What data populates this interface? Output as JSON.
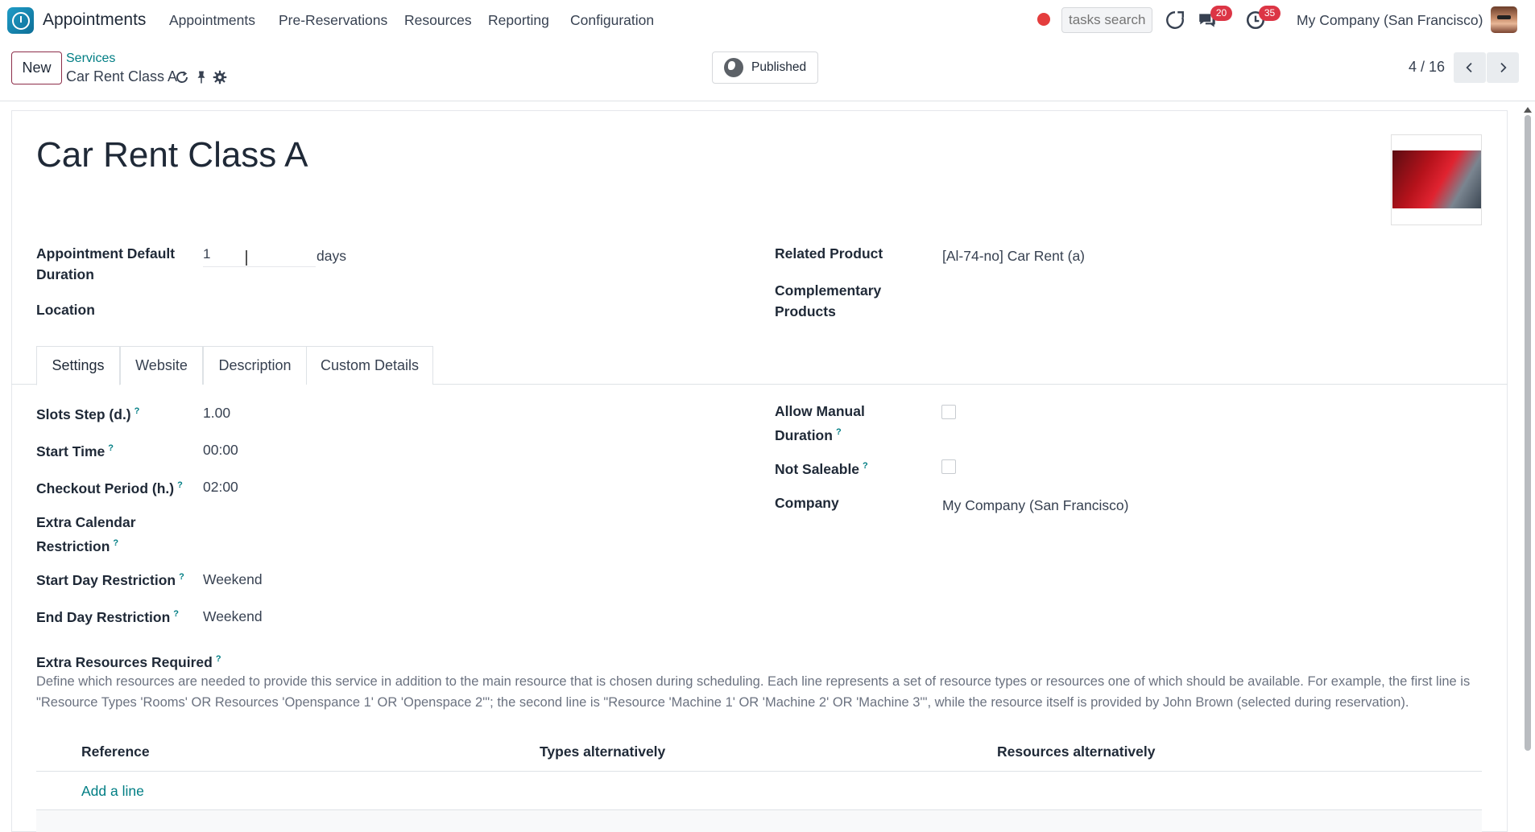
{
  "navbar": {
    "app_name": "Appointments",
    "menu": [
      "Appointments",
      "Pre-Reservations",
      "Resources",
      "Reporting",
      "Configuration"
    ],
    "search_placeholder": "tasks search",
    "messages_count": "20",
    "activities_count": "35",
    "company": "My Company (San Francisco)"
  },
  "control": {
    "new_label": "New",
    "breadcrumb_parent": "Services",
    "breadcrumb_current": "Car Rent Class A",
    "published_label": "Published",
    "pager": "4 / 16"
  },
  "record": {
    "title": "Car Rent Class A",
    "duration_label": "Appointment Default Duration",
    "duration_value": "1",
    "duration_unit": "days",
    "location_label": "Location",
    "related_product_label": "Related Product",
    "related_product_value": "[Al-74-no] Car Rent (a)",
    "complementary_label": "Complementary Products"
  },
  "tabs": [
    "Settings",
    "Website",
    "Description",
    "Custom Details"
  ],
  "settings": {
    "slots_step_label": "Slots Step (d.)",
    "slots_step_value": "1.00",
    "start_time_label": "Start Time",
    "start_time_value": "00:00",
    "checkout_label": "Checkout Period (h.)",
    "checkout_value": "02:00",
    "extra_calendar_label": "Extra Calendar Restriction",
    "start_day_label": "Start Day Restriction",
    "start_day_value": "Weekend",
    "end_day_label": "End Day Restriction",
    "end_day_value": "Weekend",
    "allow_manual_label": "Allow Manual Duration",
    "not_saleable_label": "Not Saleable",
    "company_label": "Company",
    "company_value": "My Company (San Francisco)",
    "extra_resources_label": "Extra Resources Required",
    "extra_resources_desc": "Define which resources are needed to provide this service in addition to the main resource that is chosen during scheduling. Each line represents a set of resource types or resources one of which should be available. For example, the first line is \"Resource Types 'Rooms' OR Resources 'Openspance 1' OR 'Openspace 2'\"; the second line is \"Resource 'Machine 1' OR 'Machine 2' OR 'Machine 3'\", while the resource itself is provided by John Brown (selected during reservation).",
    "table_headers": [
      "Reference",
      "Types alternatively",
      "Resources alternatively"
    ],
    "add_line": "Add a line",
    "help_mark": "?"
  },
  "colors": {
    "accent": "#017e84",
    "brand": "#8d2e4a",
    "badge": "#dc3545"
  }
}
